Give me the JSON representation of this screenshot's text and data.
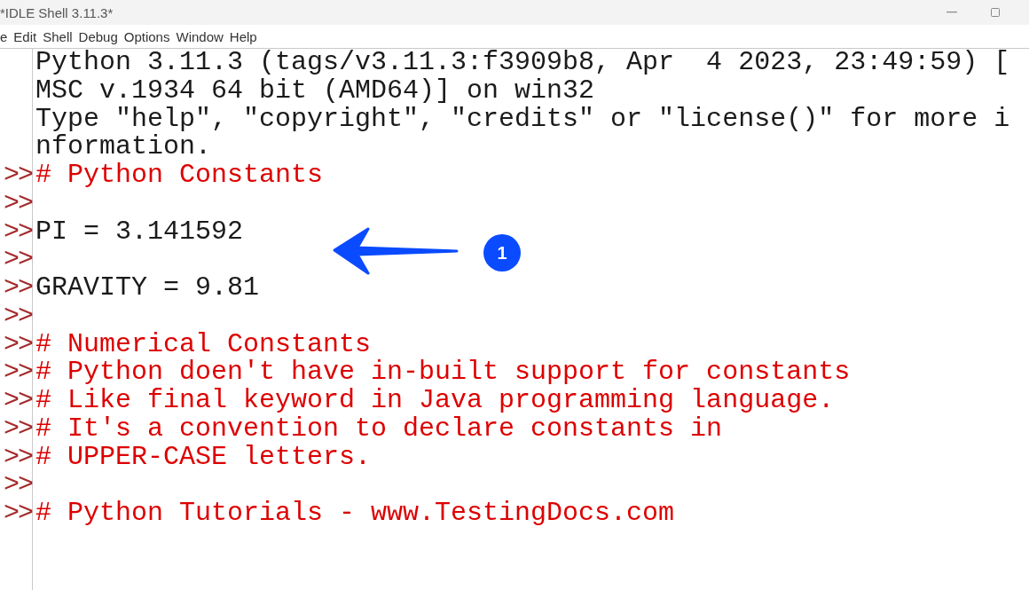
{
  "window": {
    "title": "*IDLE Shell 3.11.3*"
  },
  "menu": [
    "e",
    "Edit",
    "Shell",
    "Debug",
    "Options",
    "Window",
    "Help"
  ],
  "lines": [
    {
      "kind": "output",
      "text": "Python 3.11.3 (tags/v3.11.3:f3909b8, Apr  4 2023, 23:49:59) ["
    },
    {
      "kind": "output",
      "text": "MSC v.1934 64 bit (AMD64)] on win32"
    },
    {
      "kind": "output",
      "text": "Type \"help\", \"copyright\", \"credits\" or \"license()\" for more i"
    },
    {
      "kind": "output",
      "text": "nformation."
    },
    {
      "prompt": ">>",
      "kind": "comment",
      "text": "# Python Constants"
    },
    {
      "prompt": ">>"
    },
    {
      "prompt": ">>",
      "kind": "code",
      "text": "PI = 3.141592"
    },
    {
      "prompt": ">>"
    },
    {
      "prompt": ">>",
      "kind": "code",
      "text": "GRAVITY = 9.81"
    },
    {
      "prompt": ">>"
    },
    {
      "prompt": ">>",
      "kind": "comment",
      "text": "# Numerical Constants"
    },
    {
      "prompt": ">>",
      "kind": "comment",
      "text": "# Python doen't have in-built support for constants"
    },
    {
      "prompt": ">>",
      "kind": "comment",
      "text": "# Like final keyword in Java programming language."
    },
    {
      "prompt": ">>",
      "kind": "comment",
      "text": "# It's a convention to declare constants in"
    },
    {
      "prompt": ">>",
      "kind": "comment",
      "text": "# UPPER-CASE letters."
    },
    {
      "prompt": ">>"
    },
    {
      "prompt": ">>",
      "kind": "comment",
      "text": "# Python Tutorials - www.TestingDocs.com"
    }
  ],
  "callout": {
    "badge": "1"
  }
}
